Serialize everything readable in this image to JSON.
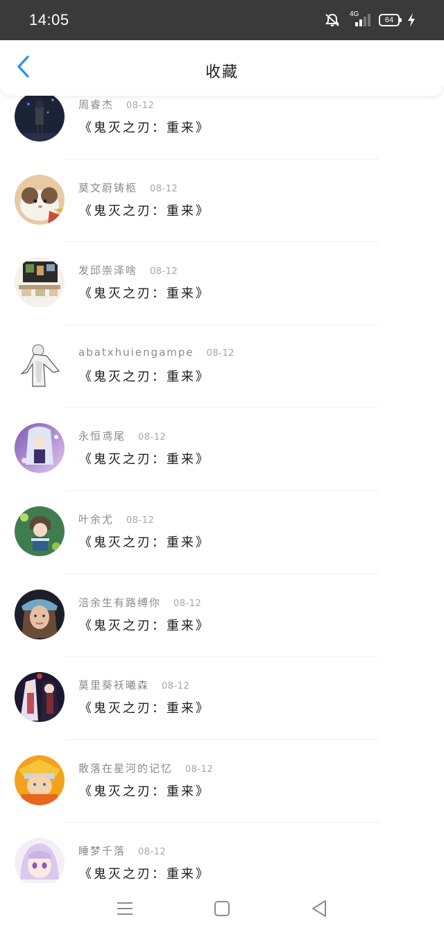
{
  "status_bar": {
    "time": "14:05",
    "network": "4G",
    "battery": "64",
    "icons": [
      "mute-icon",
      "signal-icon",
      "battery-icon",
      "charging-icon"
    ]
  },
  "header": {
    "title": "收藏",
    "back_icon": "back-arrow-icon"
  },
  "colors": {
    "accent": "#1e90ff",
    "status_bar_bg": "#3a3a3a",
    "username": "#8a8a8a",
    "title_text": "#1a1a1a"
  },
  "items": [
    {
      "user": "周睿杰",
      "date": "08-12",
      "title": "《鬼灭之刃：重来》",
      "avatar": "avatar-dark-figure"
    },
    {
      "user": "莫文蔚铸柩",
      "date": "08-12",
      "title": "《鬼灭之刃：重来》",
      "avatar": "avatar-hamster"
    },
    {
      "user": "发邱崇泽啥",
      "date": "08-12",
      "title": "《鬼灭之刃：重来》",
      "avatar": "avatar-room"
    },
    {
      "user": "abatxhuiengampe",
      "date": "08-12",
      "title": "《鬼灭之刃：重来》",
      "avatar": "avatar-sketch-figure"
    },
    {
      "user": "永恒鸢尾",
      "date": "08-12",
      "title": "《鬼灭之刃：重来》",
      "avatar": "avatar-anime-purple"
    },
    {
      "user": "叶余尤",
      "date": "08-12",
      "title": "《鬼灭之刃：重来》",
      "avatar": "avatar-anime-boy"
    },
    {
      "user": "涪余生有路缚你",
      "date": "08-12",
      "title": "《鬼灭之刃：重来》",
      "avatar": "avatar-girl-cap"
    },
    {
      "user": "莫里葵袄曦森",
      "date": "08-12",
      "title": "《鬼灭之刃：重来》",
      "avatar": "avatar-anime-couple"
    },
    {
      "user": "散落在星河的记忆",
      "date": "08-12",
      "title": "《鬼灭之刃：重来》",
      "avatar": "avatar-orange-ninja"
    },
    {
      "user": "睡梦千落",
      "date": "08-12",
      "title": "《鬼灭之刃：重来》",
      "avatar": "avatar-anime-lilac"
    }
  ],
  "navbar": {
    "icons": [
      "menu-icon",
      "home-square-icon",
      "back-triangle-icon"
    ]
  }
}
